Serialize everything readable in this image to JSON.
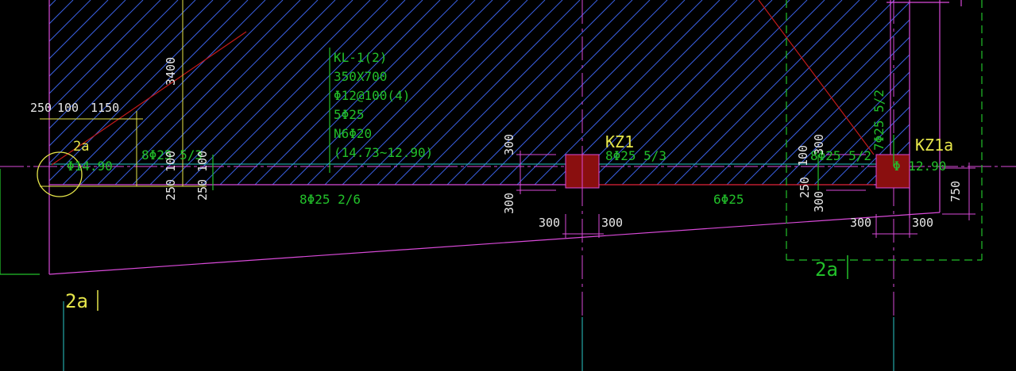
{
  "colors": {
    "background": "#000000",
    "hatch": "#3a5fe0",
    "magenta": "#d94ad9",
    "cyan": "#2ac8c8",
    "green": "#22c02a",
    "red": "#c41a1a",
    "column_fill": "#8a0f0f",
    "yellow": "#e6e64a",
    "white": "#e8e8e8"
  },
  "beam_label": {
    "line1": "KL-1(2)",
    "line2": "350X700",
    "line3": "Φ12@100(4)",
    "line4": "5Φ25",
    "line5": "N6Φ20",
    "line6": "(14.73~12.90)"
  },
  "columns": {
    "kz1": "KZ1",
    "kz1a": "KZ1a"
  },
  "rebar": {
    "left_top": "8Φ25 5/3",
    "mid_top": "8Φ25 5/3",
    "right_top": "8Φ25 5/2",
    "bottom_left": "8Φ25 2/6",
    "bottom_right": "6Φ25",
    "right_vertical": "7Φ25 5/2"
  },
  "elevations": {
    "left": "Φ14.90",
    "right": "Φ 12.90"
  },
  "dimensions": {
    "d250_top": "250",
    "d100_top": "100",
    "d1150": "1150",
    "d3400": "3400",
    "d100_v": "100",
    "d100_v2": "100",
    "d250_v": "250",
    "d250_v2": "250",
    "d300_a": "300",
    "d300_b": "300",
    "d300_c": "300",
    "d300_d": "300",
    "d300_e": "300",
    "d300_f": "300",
    "d300_g": "300",
    "d300_h": "300",
    "d250_r": "250",
    "d300_r": "300",
    "d100_r": "100",
    "d750": "750"
  },
  "markers": {
    "two_a_small": "2a",
    "two_a_left": "2a",
    "two_a_right": "2a"
  }
}
